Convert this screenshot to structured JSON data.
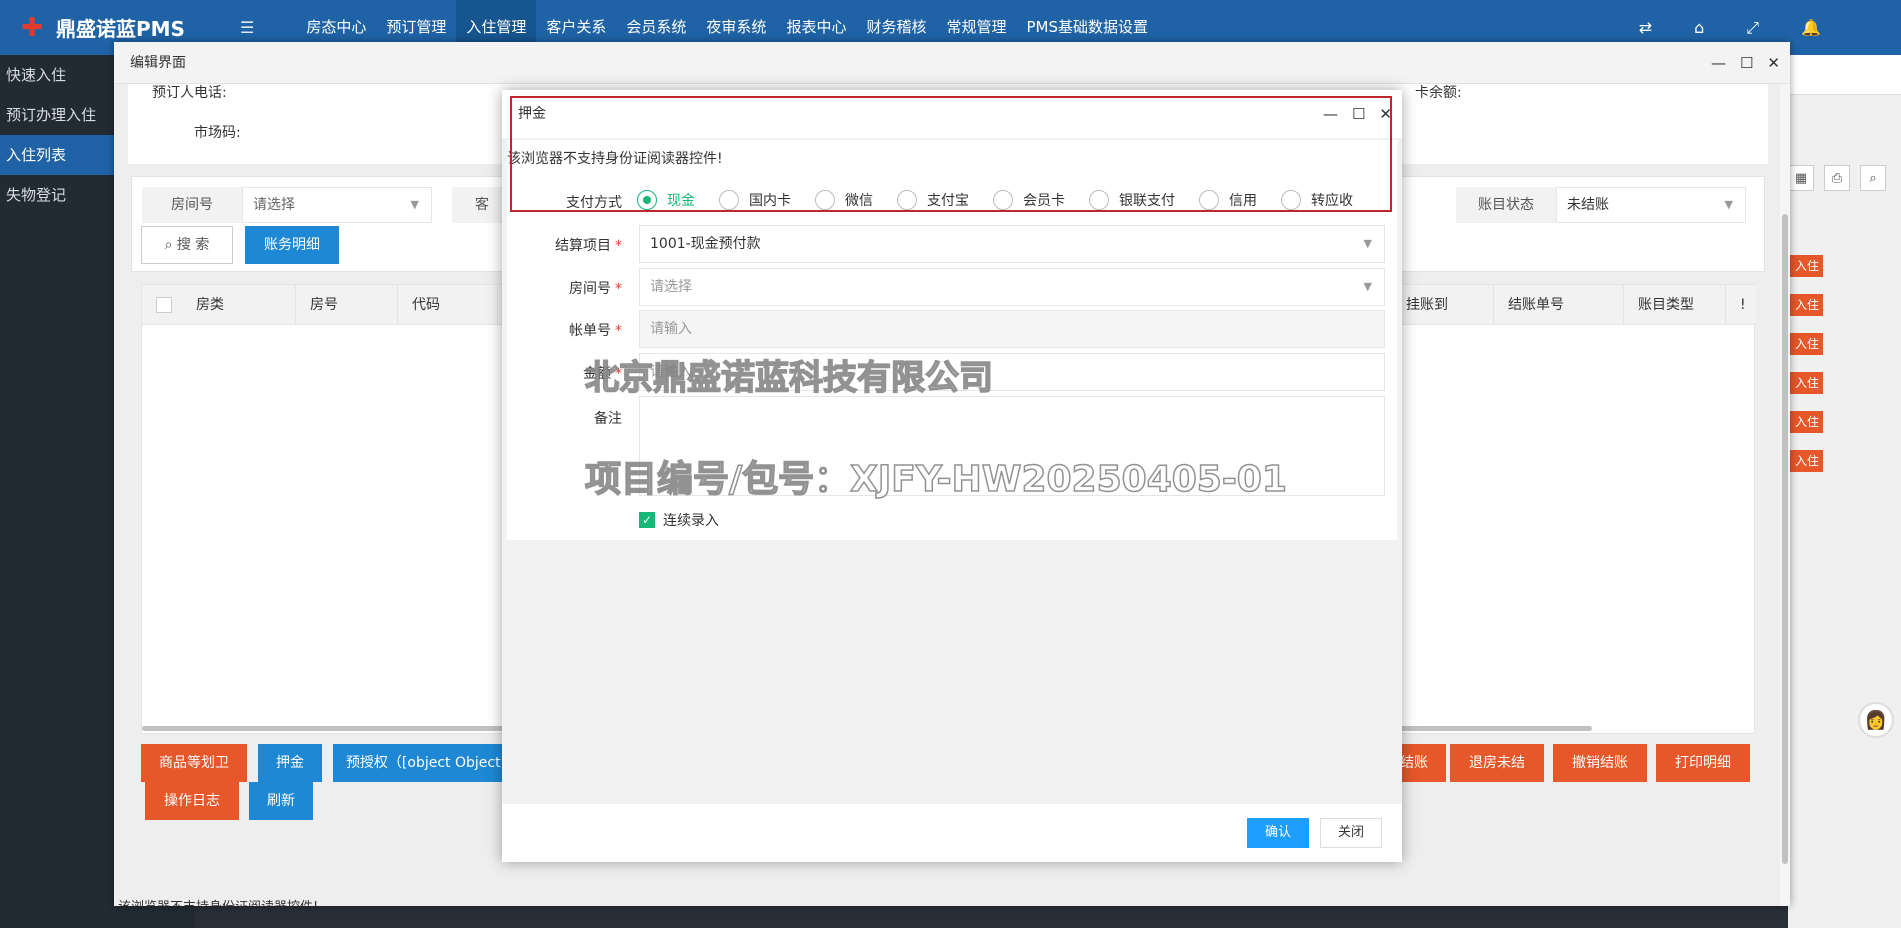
{
  "app": {
    "name": "鼎盛诺蓝PMS",
    "logo_text": "鼎盛诺蓝"
  },
  "topnav": {
    "items": [
      "房态中心",
      "预订管理",
      "入住管理",
      "客户关系",
      "会员系统",
      "夜审系统",
      "报表中心",
      "财务稽核",
      "常规管理",
      "PMS基础数据设置"
    ],
    "active_index": 2
  },
  "sidebar": {
    "items": [
      "快速入住",
      "预订办理入住",
      "入住列表",
      "失物登记"
    ],
    "active_index": 2
  },
  "outer_window": {
    "title": "编辑界面",
    "booker_phone_label": "预订人电话:",
    "market_code_label": "市场码:",
    "card_balance_label": "卡余额:",
    "filter": {
      "room_label": "房间号",
      "room_placeholder": "请选择",
      "guest_label_fragment": "客",
      "account_status_label": "账目状态",
      "account_status_value": "未结账"
    },
    "search_button": "搜 索",
    "details_button": "账务明细",
    "table_headers": [
      "房类",
      "房号",
      "代码",
      "挂账到",
      "结账单号",
      "账目类型",
      "!"
    ],
    "buttons_row1": [
      "商品等划卫",
      "押金",
      "预授权（[object Object]）",
      "结账",
      "退房未结",
      "撤销结账",
      "打印明细"
    ],
    "buttons_row2": [
      "操作日志",
      "刷新"
    ],
    "status_text": "该浏览器不支持身份证阅读器控件!"
  },
  "right_strip": {
    "btn_label": "入住",
    "count": 6
  },
  "dialog": {
    "title": "押金",
    "reader_message": "该浏览器不支持身份证阅读器控件!",
    "payment_label": "支付方式",
    "payment_options": [
      "现金",
      "国内卡",
      "微信",
      "支付宝",
      "会员卡",
      "银联支付",
      "信用",
      "转应收"
    ],
    "payment_selected_index": 0,
    "settle_item_label": "结算项目",
    "settle_item_value": "1001-现金预付款",
    "room_label": "房间号",
    "room_placeholder": "请选择",
    "bill_label": "帐单号",
    "bill_placeholder": "请输入",
    "amount_label": "金额",
    "amount_placeholder": "请输入",
    "remark_label": "备注",
    "continuous_label": "连续录入",
    "confirm_button": "确认",
    "close_button": "关闭"
  },
  "watermark": {
    "line1": "北京鼎盛诺蓝科技有限公司",
    "line2": "项目编号/包号：XJFY-HW20250405-01"
  },
  "colors": {
    "topbar": "#1f63a6",
    "sidebar": "#222a34",
    "accent_green": "#16b777",
    "primary_blue": "#1e9fff",
    "button_red": "#e6572a",
    "highlight": "#c0262d"
  }
}
